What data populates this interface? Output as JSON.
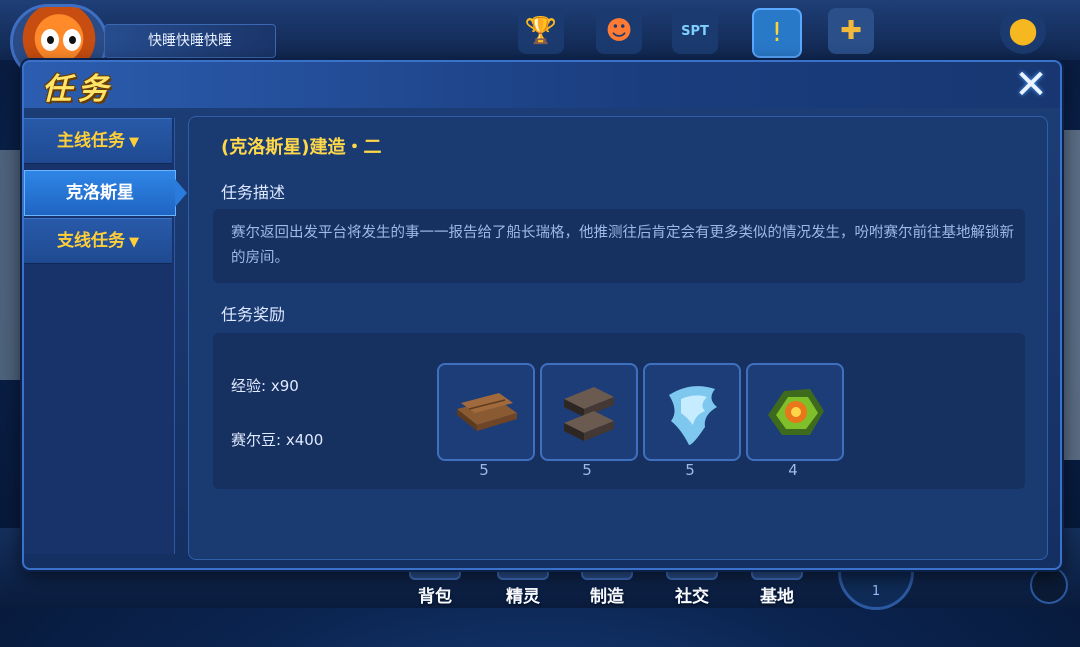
{
  "hud": {
    "player_name": "快睡快睡快睡",
    "icons": [
      "avatar-icon",
      "trophy-icon",
      "character-face-icon",
      "spt-icon",
      "alert-icon",
      "plus-badge-icon",
      "map-pin-icon"
    ],
    "spt_label": "SPT"
  },
  "dialog": {
    "title": "任务",
    "close_icon": "close-icon",
    "sidebar": {
      "items": [
        {
          "label": "主线任务",
          "type": "category",
          "expanded": true
        },
        {
          "label": "克洛斯星",
          "type": "entry",
          "selected": true
        },
        {
          "label": "支线任务",
          "type": "category",
          "expanded": false
        }
      ]
    },
    "quest": {
      "title": "(克洛斯星)建造・二",
      "desc_label": "任务描述",
      "description": "赛尔返回出发平台将发生的事一一报告给了船长瑞格，他推测往后肯定会有更多类似的情况发生，吩咐赛尔前往基地解锁新的房间。",
      "reward_label": "任务奖励",
      "exp": "经验: x90",
      "beans": "赛尔豆: x400",
      "items": [
        {
          "icon": "wood-planks-icon",
          "count": "5"
        },
        {
          "icon": "iron-bars-icon",
          "count": "5"
        },
        {
          "icon": "ice-crystal-icon",
          "count": "5"
        },
        {
          "icon": "energy-core-icon",
          "count": "4"
        }
      ]
    }
  },
  "bottom_nav": {
    "items": [
      {
        "label": "背包",
        "icon": "backpack-icon"
      },
      {
        "label": "精灵",
        "icon": "spirit-icon"
      },
      {
        "label": "制造",
        "icon": "crafting-icon"
      },
      {
        "label": "社交",
        "icon": "social-icon"
      },
      {
        "label": "基地",
        "icon": "base-icon"
      }
    ],
    "round_badge": "1"
  },
  "colors": {
    "accent_gold": "#ffd84a",
    "active_tab": "#2f86e6",
    "panel": "#1a3a72",
    "desc_text": "#9db9e6"
  }
}
